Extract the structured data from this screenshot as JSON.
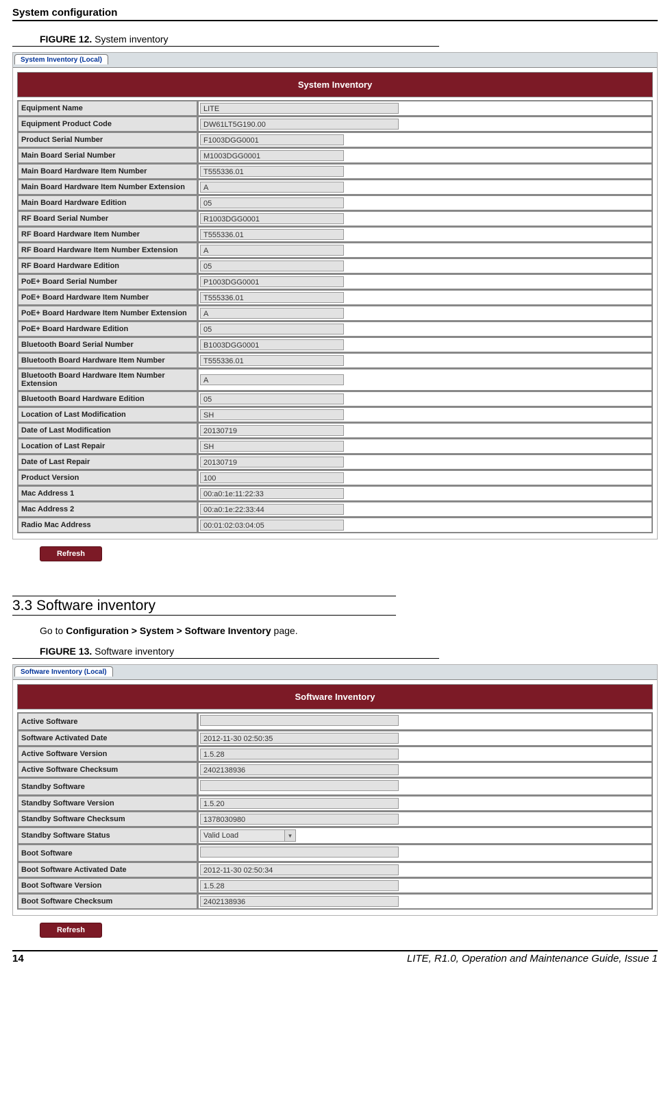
{
  "header": "System configuration",
  "fig12": {
    "caption_bold": "FIGURE 12.",
    "caption_text": " System inventory",
    "tab": "System Inventory (Local)",
    "title": "System Inventory",
    "rows": [
      {
        "label": "Equipment Name",
        "value": "LITE",
        "wide": true
      },
      {
        "label": "Equipment Product Code",
        "value": "DW61LT5G190.00",
        "wide": true
      },
      {
        "label": "Product Serial Number",
        "value": "F1003DGG0001"
      },
      {
        "label": "Main Board Serial Number",
        "value": "M1003DGG0001"
      },
      {
        "label": "Main Board Hardware Item Number",
        "value": "T555336.01"
      },
      {
        "label": "Main Board Hardware Item Number Extension",
        "value": "A"
      },
      {
        "label": "Main Board Hardware Edition",
        "value": "05"
      },
      {
        "label": "RF Board Serial Number",
        "value": "R1003DGG0001"
      },
      {
        "label": "RF Board Hardware Item Number",
        "value": "T555336.01"
      },
      {
        "label": "RF Board Hardware Item Number Extension",
        "value": "A"
      },
      {
        "label": "RF Board Hardware Edition",
        "value": "05"
      },
      {
        "label": "PoE+ Board Serial Number",
        "value": "P1003DGG0001"
      },
      {
        "label": "PoE+ Board Hardware Item Number",
        "value": "T555336.01"
      },
      {
        "label": "PoE+ Board Hardware Item Number Extension",
        "value": "A"
      },
      {
        "label": "PoE+ Board Hardware Edition",
        "value": "05"
      },
      {
        "label": "Bluetooth Board Serial Number",
        "value": "B1003DGG0001"
      },
      {
        "label": "Bluetooth Board Hardware Item Number",
        "value": "T555336.01"
      },
      {
        "label": "Bluetooth Board Hardware Item Number Extension",
        "value": "A"
      },
      {
        "label": "Bluetooth Board Hardware Edition",
        "value": "05"
      },
      {
        "label": "Location of Last Modification",
        "value": "SH"
      },
      {
        "label": "Date of Last Modification",
        "value": "20130719"
      },
      {
        "label": "Location of Last Repair",
        "value": "SH"
      },
      {
        "label": "Date of Last Repair",
        "value": "20130719"
      },
      {
        "label": "Product Version",
        "value": "100"
      },
      {
        "label": "Mac Address 1",
        "value": "00:a0:1e:11:22:33"
      },
      {
        "label": "Mac Address 2",
        "value": "00:a0:1e:22:33:44"
      },
      {
        "label": "Radio Mac Address",
        "value": "00:01:02:03:04:05"
      }
    ],
    "refresh": "Refresh"
  },
  "section33": {
    "heading": "3.3 Software inventory",
    "text_pre": "Go to ",
    "text_bold": "Configuration > System > Software Inventory",
    "text_post": " page."
  },
  "fig13": {
    "caption_bold": "FIGURE 13.",
    "caption_text": " Software inventory",
    "tab": "Software Inventory (Local)",
    "title": "Software Inventory",
    "rows": [
      {
        "label": "Active Software",
        "value": ""
      },
      {
        "label": "Software Activated Date",
        "value": "2012-11-30 02:50:35"
      },
      {
        "label": "Active Software Version",
        "value": "1.5.28"
      },
      {
        "label": "Active Software Checksum",
        "value": "2402138936"
      },
      {
        "label": "Standby Software",
        "value": ""
      },
      {
        "label": "Standby Software Version",
        "value": "1.5.20"
      },
      {
        "label": "Standby Software Checksum",
        "value": "1378030980"
      },
      {
        "label": "Standby Software Status",
        "value": "Valid Load",
        "select": true
      },
      {
        "label": "Boot Software",
        "value": ""
      },
      {
        "label": "Boot Software Activated Date",
        "value": "2012-11-30 02:50:34"
      },
      {
        "label": "Boot Software Version",
        "value": "1.5.28"
      },
      {
        "label": "Boot Software Checksum",
        "value": "2402138936"
      }
    ],
    "refresh": "Refresh"
  },
  "footer": {
    "page": "14",
    "title": "LITE, R1.0, Operation and Maintenance Guide, Issue 1"
  }
}
